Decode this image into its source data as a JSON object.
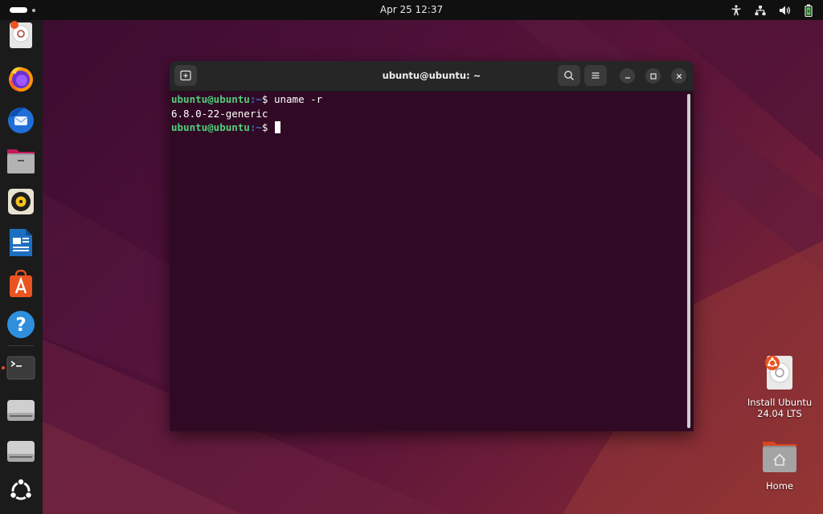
{
  "topbar": {
    "clock": "Apr 25  12:37",
    "tray_icons": [
      "accessibility-icon",
      "network-icon",
      "volume-icon",
      "battery-icon"
    ]
  },
  "dock": {
    "items": [
      {
        "name": "installer",
        "icon": "install-ubuntu-icon"
      },
      {
        "name": "firefox",
        "icon": "firefox-icon"
      },
      {
        "name": "thunderbird",
        "icon": "thunderbird-icon"
      },
      {
        "name": "files",
        "icon": "files-icon"
      },
      {
        "name": "rhythmbox",
        "icon": "rhythmbox-icon"
      },
      {
        "name": "libreoffice-writer",
        "icon": "writer-icon"
      },
      {
        "name": "app-center",
        "icon": "app-center-icon"
      },
      {
        "name": "help",
        "icon": "help-icon"
      },
      {
        "name": "terminal",
        "icon": "terminal-icon",
        "running": true
      },
      {
        "name": "drive-1",
        "icon": "drive-icon"
      },
      {
        "name": "drive-2",
        "icon": "drive-icon"
      },
      {
        "name": "show-apps",
        "icon": "ubuntu-logo-icon"
      }
    ]
  },
  "terminal": {
    "title": "ubuntu@ubuntu: ~",
    "lines": [
      {
        "user": "ubuntu@ubuntu",
        "path": ":~",
        "prompt": "$ ",
        "command": "uname -r"
      },
      {
        "output": "6.8.0-22-generic"
      },
      {
        "user": "ubuntu@ubuntu",
        "path": ":~",
        "prompt": "$ ",
        "command": ""
      }
    ],
    "colors": {
      "background": "#300a24",
      "user": "#4fcf7a",
      "path": "#3c6fd8"
    }
  },
  "desktop": {
    "icons": [
      {
        "label": "Install Ubuntu 24.04 LTS",
        "label_line1": "Install Ubuntu",
        "label_line2": "24.04 LTS",
        "icon": "install-ubuntu-icon"
      },
      {
        "label": "Home",
        "icon": "home-folder-icon"
      }
    ]
  },
  "colors": {
    "accent": "#e95420",
    "topbar": "#101010",
    "dock": "#1b1b1b"
  }
}
